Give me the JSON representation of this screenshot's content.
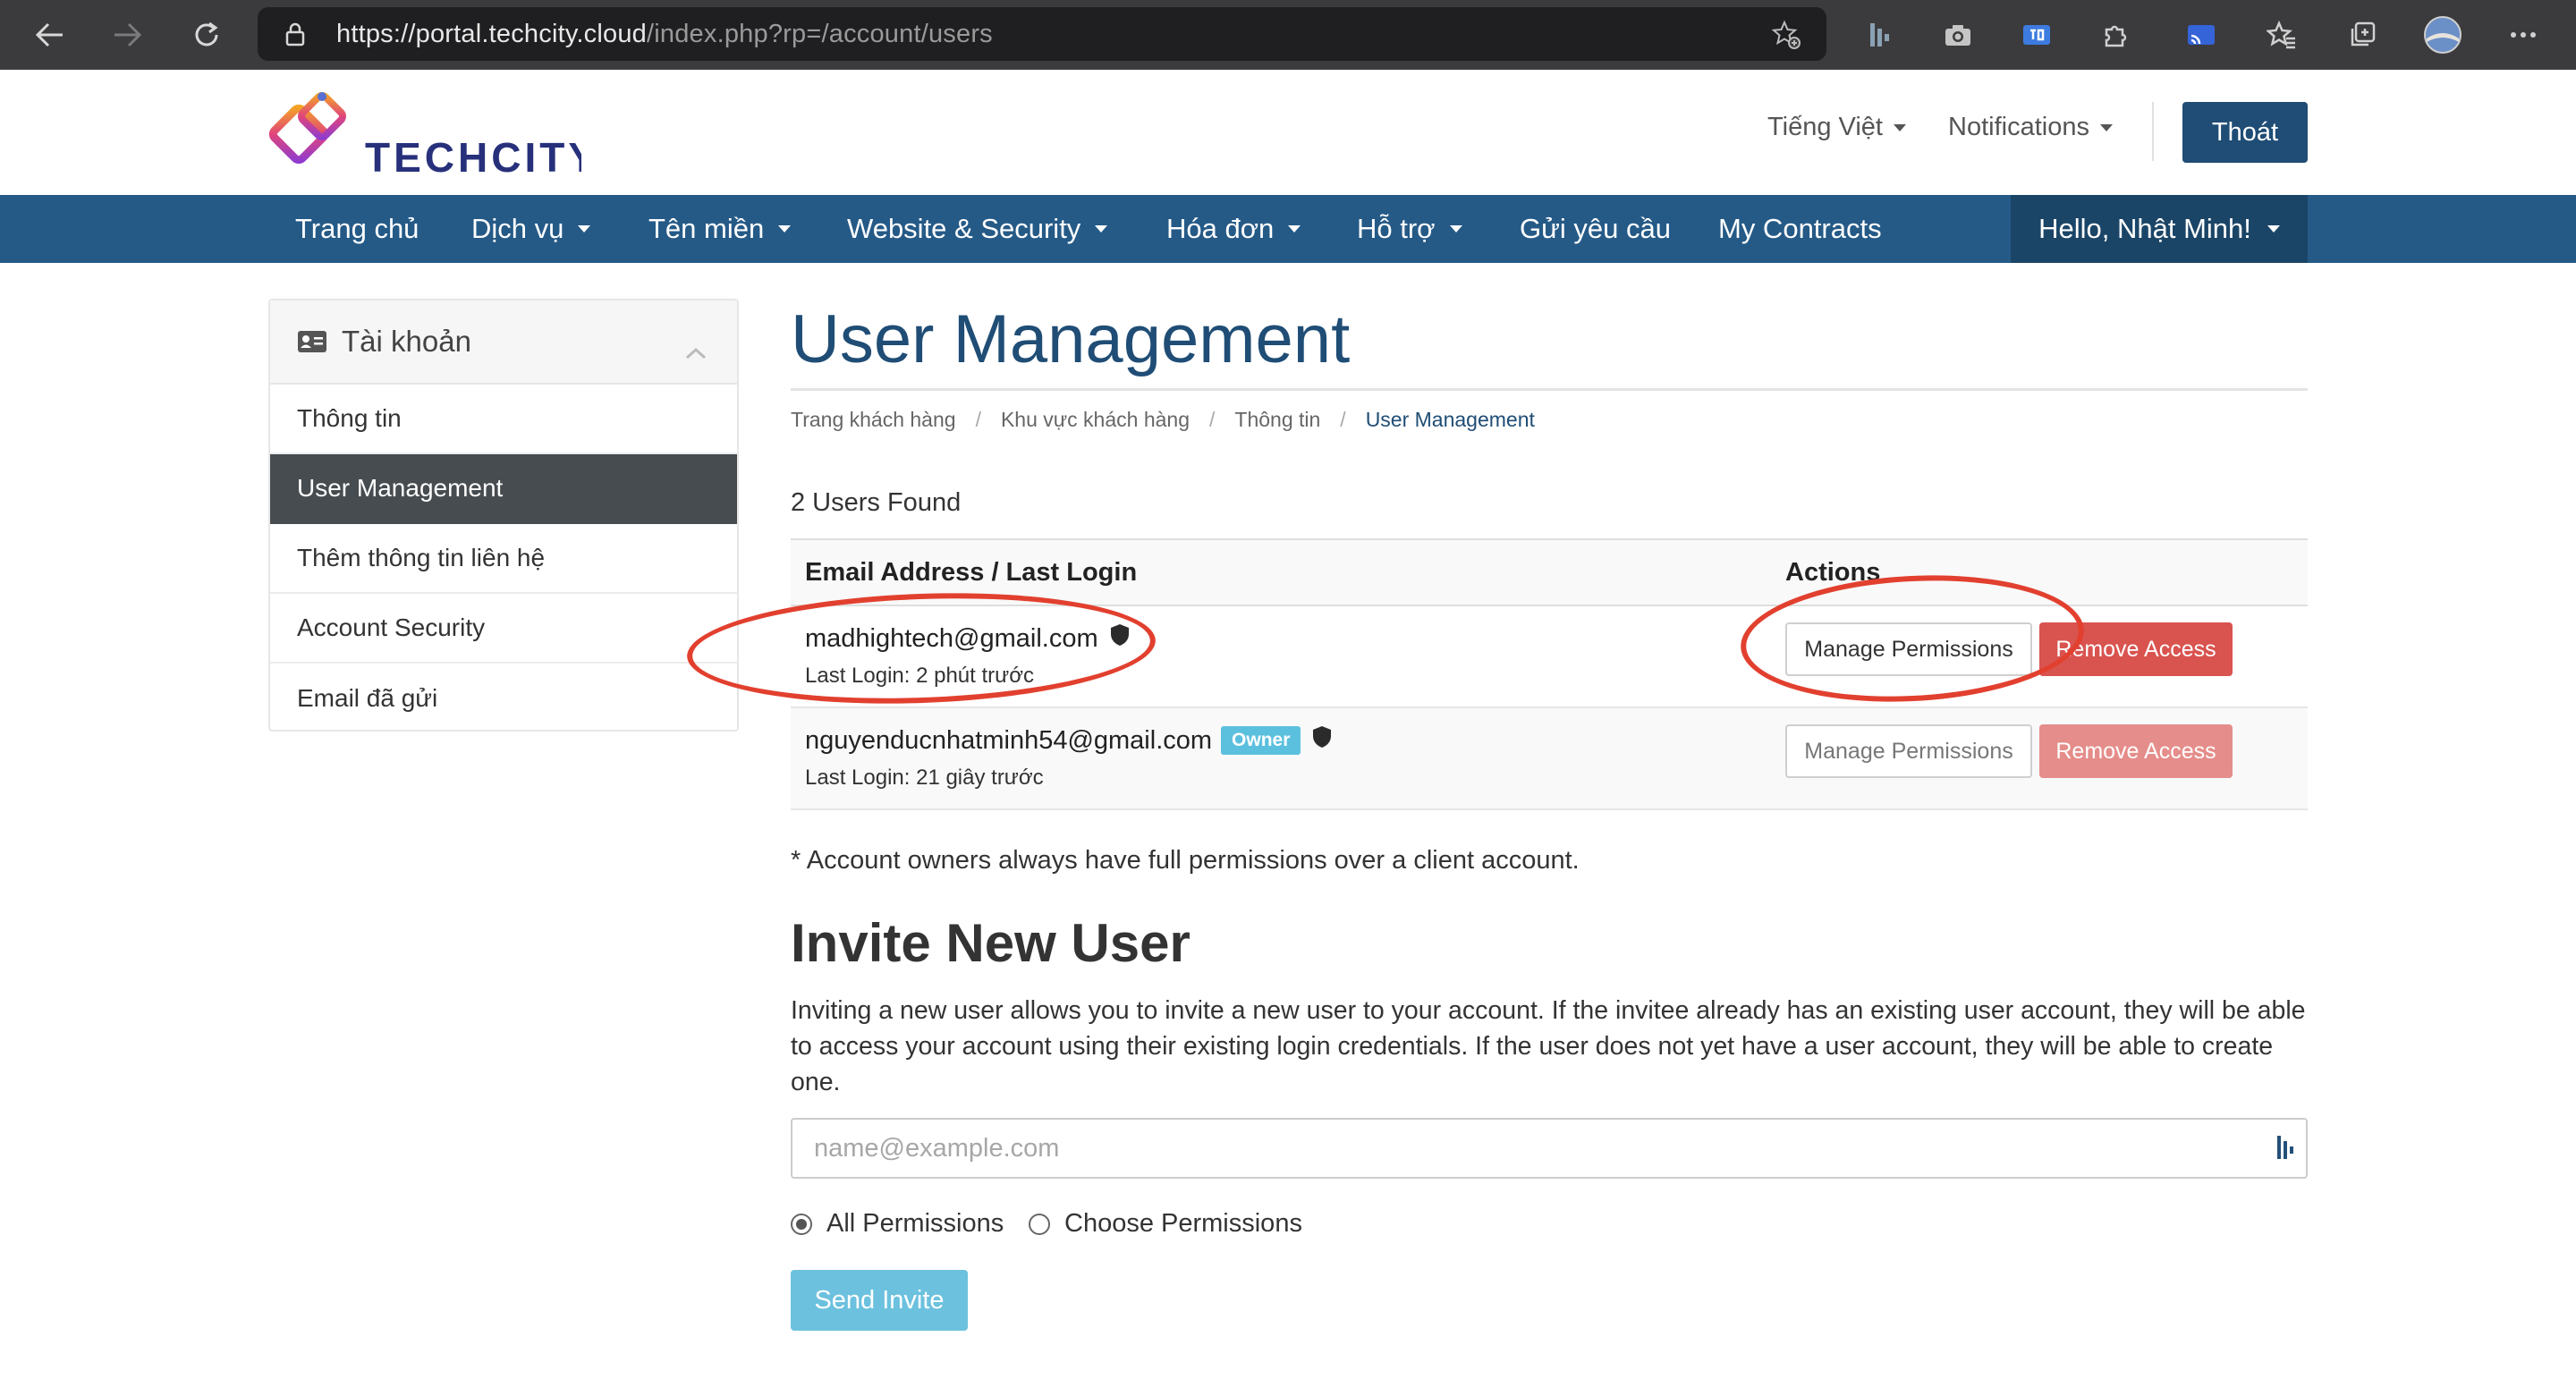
{
  "browser": {
    "url_host": "https://portal.techcity.cloud",
    "url_path": "/index.php?rp=/account/users"
  },
  "header": {
    "logo_text": "TECHCITY",
    "language": "Tiếng Việt",
    "notifications": "Notifications",
    "logout": "Thoát"
  },
  "nav": {
    "items": [
      "Trang chủ",
      "Dịch vụ",
      "Tên miền",
      "Website & Security",
      "Hóa đơn",
      "Hỗ trợ",
      "Gửi yêu cầu",
      "My Contracts"
    ],
    "hello": "Hello, Nhật Minh!"
  },
  "sidebar": {
    "title": "Tài khoản",
    "items": [
      "Thông tin",
      "User Management",
      "Thêm thông tin liên hệ",
      "Account Security",
      "Email đã gửi"
    ]
  },
  "page": {
    "title": "User Management",
    "breadcrumb": [
      "Trang khách hàng",
      "Khu vực khách hàng",
      "Thông tin",
      "User Management"
    ],
    "users_found": "2 Users Found"
  },
  "table": {
    "col_email": "Email Address / Last Login",
    "col_actions": "Actions",
    "rows": [
      {
        "email": "madhightech@gmail.com",
        "last_login": "Last Login: 2 phút trước",
        "badge": ""
      },
      {
        "email": "nguyenducnhatminh54@gmail.com",
        "last_login": "Last Login: 21 giây trước",
        "badge": "Owner"
      }
    ],
    "manage_label": "Manage Permissions",
    "remove_label": "Remove Access"
  },
  "owner_note": "* Account owners always have full permissions over a client account.",
  "invite": {
    "title": "Invite New User",
    "description": "Inviting a new user allows you to invite a new user to your account. If the invitee already has an existing user account, they will be able to access your account using their existing login credentials. If the user does not yet have a user account, they will be able to create one.",
    "placeholder": "name@example.com",
    "value": "",
    "all_permissions": "All Permissions",
    "choose_permissions": "Choose Permissions",
    "selected_permission": "All Permissions",
    "send": "Send Invite"
  },
  "colors": {
    "nav_bg": "#255a87",
    "brand_dark": "#1f4d75",
    "danger": "#d9534f",
    "info": "#5bc0de",
    "annotation": "#e2402f"
  }
}
